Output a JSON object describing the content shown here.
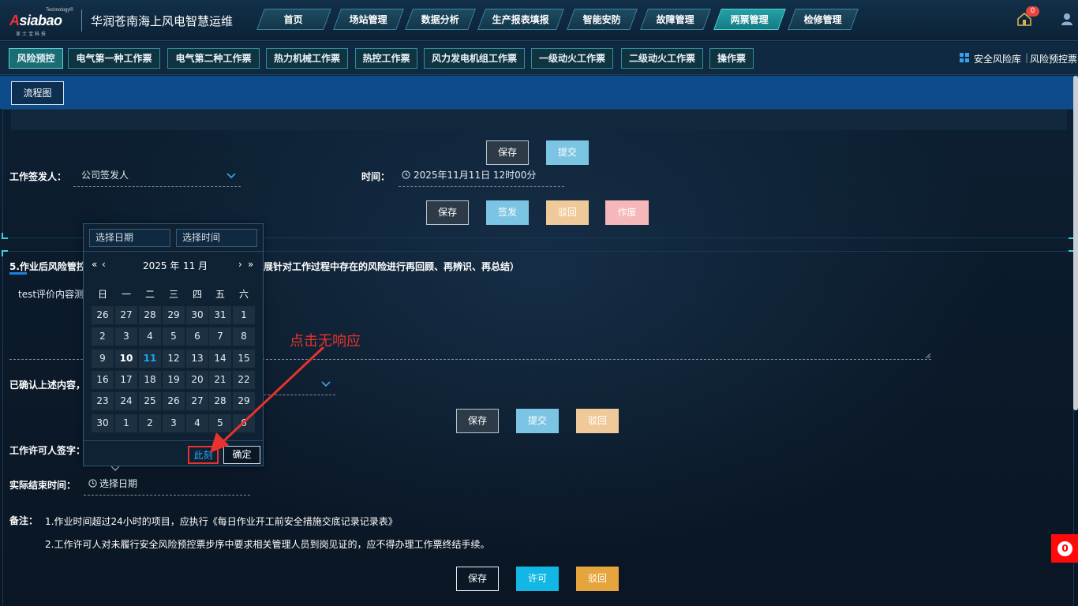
{
  "header": {
    "logo_text": "Asiabao",
    "logo_tech": "Technology®",
    "logo_cn": "亚士宝科技",
    "system_title": "华润苍南海上风电智慧运维",
    "notification_count": "0",
    "nav": [
      {
        "label": "首页",
        "active": false
      },
      {
        "label": "场站管理",
        "active": false
      },
      {
        "label": "数据分析",
        "active": false
      },
      {
        "label": "生产报表填报",
        "active": false
      },
      {
        "label": "智能安防",
        "active": false
      },
      {
        "label": "故障管理",
        "active": false
      },
      {
        "label": "两票管理",
        "active": true
      },
      {
        "label": "检修管理",
        "active": false
      }
    ]
  },
  "subnav": {
    "items": [
      {
        "label": "风险预控",
        "active": true
      },
      {
        "label": "电气第一种工作票",
        "active": false
      },
      {
        "label": "电气第二种工作票",
        "active": false
      },
      {
        "label": "热力机械工作票",
        "active": false
      },
      {
        "label": "热控工作票",
        "active": false
      },
      {
        "label": "风力发电机组工作票",
        "active": false
      },
      {
        "label": "一级动火工作票",
        "active": false
      },
      {
        "label": "二级动火工作票",
        "active": false
      },
      {
        "label": "操作票",
        "active": false
      }
    ],
    "safety_library": "安全风险库",
    "sep": "|",
    "risk_control": "风险预控票"
  },
  "toolbar": {
    "flowchart": "流程图"
  },
  "section1": {
    "save": "保存",
    "submit": "提交",
    "signer_label": "工作签发人：",
    "signer_value": "公司签发人",
    "time_label": "时间：",
    "time_value": "2025年11月11日 12时00分",
    "save2": "保存",
    "sign": "签发",
    "reject": "驳回",
    "void": "作废"
  },
  "section2": {
    "title_left": "5.作业后风险管控",
    "title_right": "展针对工作过程中存在的风险进行再回顾、再辨识、再总结）",
    "eval_text": "test评价内容测",
    "confirm_label": "已确认上述内容，",
    "save": "保存",
    "submit": "提交",
    "reject": "驳回",
    "permit_sign_label": "工作许可人签字：",
    "end_time_label": "实际结束时间：",
    "end_time_placeholder": "选择日期",
    "remark_label": "备注：",
    "remark1": "1.作业时间超过24小时的项目，应执行《每日作业开工前安全措施交底记录记录表》",
    "remark2": "2.工作许可人对未履行安全风险预控票步序中要求相关管理人员到岗见证的，应不得办理工作票终结手续。",
    "save_final": "保存",
    "permit": "许可",
    "reject_final": "驳回"
  },
  "datepicker": {
    "date_placeholder": "选择日期",
    "time_placeholder": "选择时间",
    "year": "2025 年",
    "month": "11 月",
    "prev_year": "«",
    "prev_month": "‹",
    "next_month": "›",
    "next_year": "»",
    "weekdays": [
      "日",
      "一",
      "二",
      "三",
      "四",
      "五",
      "六"
    ],
    "weeks": [
      [
        "26",
        "27",
        "28",
        "29",
        "30",
        "31",
        "1"
      ],
      [
        "2",
        "3",
        "4",
        "5",
        "6",
        "7",
        "8"
      ],
      [
        "9",
        "10",
        "11",
        "12",
        "13",
        "14",
        "15"
      ],
      [
        "16",
        "17",
        "18",
        "19",
        "20",
        "21",
        "22"
      ],
      [
        "23",
        "24",
        "25",
        "26",
        "27",
        "28",
        "29"
      ],
      [
        "30",
        "1",
        "2",
        "3",
        "4",
        "5",
        "6"
      ]
    ],
    "now_btn": "此刻",
    "ok_btn": "确定"
  },
  "annotation": {
    "text": "点击无响应",
    "color": "#e8322d"
  },
  "float_badge": "0",
  "colors": {
    "accent_cyan": "#3bd1e6",
    "blue_bar": "#0e4b8a",
    "active_nav": "#25a1a6"
  }
}
